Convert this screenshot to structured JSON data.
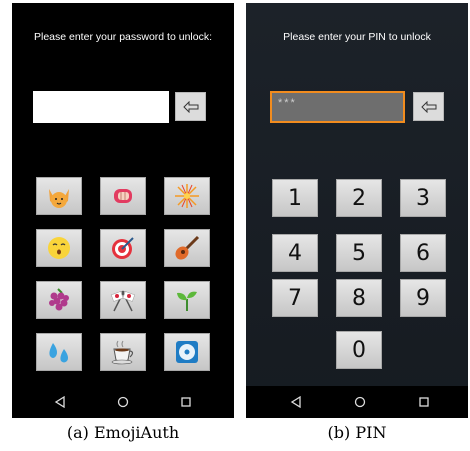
{
  "panel_a": {
    "prompt": "Please enter your password to unlock:",
    "password_value": "",
    "emoji_keys": [
      "cat-face",
      "fisted-hand",
      "fireworks",
      "hushed-face",
      "direct-hit",
      "guitar",
      "grapes",
      "crossed-flags",
      "seedling",
      "splashing-sweat",
      "hot-beverage",
      "optical-disc"
    ],
    "caption": "(a) EmojiAuth"
  },
  "panel_b": {
    "prompt": "Please enter your PIN to unlock",
    "pin_value": "***",
    "digit_keys": [
      "1",
      "2",
      "3",
      "4",
      "5",
      "6",
      "7",
      "8",
      "9",
      "0"
    ],
    "caption": "(b) PIN"
  },
  "navbar": {
    "icons": [
      "back-triangle-icon",
      "home-circle-icon",
      "recents-square-icon"
    ]
  },
  "colors": {
    "focus_border": "#f28c1e",
    "screen_b_bg": "#1b2026"
  }
}
